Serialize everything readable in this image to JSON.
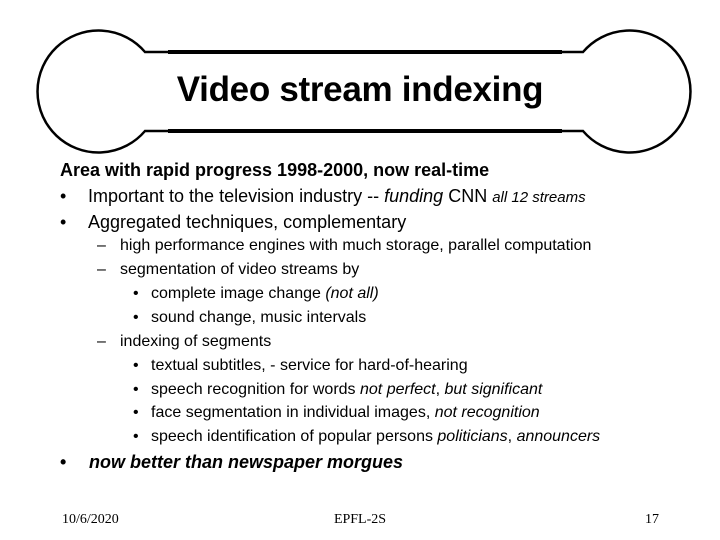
{
  "slide": {
    "title": "Video stream indexing",
    "heading": "Area with rapid progress  1998-2000, now real-time",
    "bullet_char": "•",
    "dash_char": "–",
    "sub_bullet_char": "•",
    "items": [
      {
        "level": 1,
        "parts": [
          {
            "text": "Important to the television industry -- ",
            "style": "normal"
          },
          {
            "text": "funding",
            "style": "italic"
          },
          {
            "text": "  CNN ",
            "style": "normal"
          },
          {
            "text": "all 12 streams",
            "style": "italic-small"
          }
        ]
      },
      {
        "level": 1,
        "parts": [
          {
            "text": "Aggregated techniques, complementary",
            "style": "normal"
          }
        ]
      },
      {
        "level": 2,
        "parts": [
          {
            "text": "high performance engines with much storage, parallel computation",
            "style": "normal"
          }
        ]
      },
      {
        "level": 2,
        "parts": [
          {
            "text": "segmentation of video streams by",
            "style": "normal"
          }
        ]
      },
      {
        "level": 3,
        "parts": [
          {
            "text": "complete image change  ",
            "style": "normal"
          },
          {
            "text": "(not all)",
            "style": "italic"
          }
        ]
      },
      {
        "level": 3,
        "parts": [
          {
            "text": "sound change, music intervals",
            "style": "normal"
          }
        ]
      },
      {
        "level": 2,
        "parts": [
          {
            "text": "indexing of segments",
            "style": "normal"
          }
        ]
      },
      {
        "level": 3,
        "parts": [
          {
            "text": "textual subtitles, - service for hard-of-hearing",
            "style": "normal"
          }
        ]
      },
      {
        "level": 3,
        "parts": [
          {
            "text": "speech recognition for words  ",
            "style": "normal"
          },
          {
            "text": "not perfect",
            "style": "italic"
          },
          {
            "text": ", ",
            "style": "normal"
          },
          {
            "text": "but significant",
            "style": "italic"
          }
        ]
      },
      {
        "level": 3,
        "parts": [
          {
            "text": "face segmentation in individual images, ",
            "style": "normal"
          },
          {
            "text": "not recognition",
            "style": "italic"
          }
        ]
      },
      {
        "level": 3,
        "parts": [
          {
            "text": "speech identification of popular persons ",
            "style": "normal"
          },
          {
            "text": "politicians",
            "style": "italic"
          },
          {
            "text": ", ",
            "style": "normal"
          },
          {
            "text": "announcers",
            "style": "italic"
          }
        ]
      }
    ],
    "conclusion": "now better than newspaper morgues"
  },
  "footer": {
    "date": "10/6/2020",
    "center": "EPFL-2S",
    "page_number": "17"
  }
}
